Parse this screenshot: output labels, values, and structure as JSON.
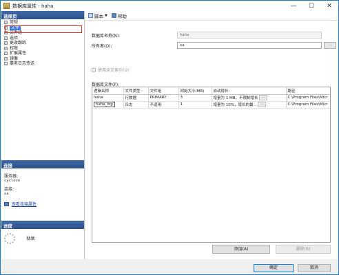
{
  "window": {
    "title": "数据库属性 - haha"
  },
  "left": {
    "select_page_heading": "选择页",
    "pages": [
      {
        "label": "常规"
      },
      {
        "label": "文件"
      },
      {
        "label": "文件组"
      },
      {
        "label": "选项"
      },
      {
        "label": "更改跟踪"
      },
      {
        "label": "权限"
      },
      {
        "label": "扩展属性"
      },
      {
        "label": "镜像"
      },
      {
        "label": "事务日志传送"
      }
    ],
    "connection_heading": "连接",
    "server_label": "服务器:",
    "server_value": "cyclove",
    "connection_label": "连接:",
    "connection_value": "sa",
    "view_link": "查看连接属性",
    "progress_heading": "进度",
    "progress_status": "就绪"
  },
  "toolbar": {
    "script": "脚本",
    "help": "帮助"
  },
  "form": {
    "db_name_label": "数据库名称(N):",
    "db_name_value": "haha",
    "owner_label": "所有者(O):",
    "owner_value": "sa",
    "fulltext_label": "使用全文索引(U)",
    "files_label": "数据库文件(F):"
  },
  "files_table": {
    "headers": [
      "逻辑名称",
      "文件类型",
      "文件组",
      "初始大小(MB)",
      "自动增长",
      "路径"
    ],
    "rows": [
      {
        "name": "haha",
        "type": "行数据",
        "group": "PRIMARY",
        "size": "3",
        "growth": "增量为 1 MB，不限制增长",
        "path": "C:\\Program Files\\Micr"
      },
      {
        "name": "haha_log",
        "type": "日志",
        "group": "不适用",
        "size": "1",
        "growth": "增量为 10%，增长的最...",
        "path": "C:\\Program Files\\Micr"
      }
    ]
  },
  "buttons": {
    "add": "添加(A)",
    "remove": "删除(R)",
    "ok": "确定",
    "cancel": "取消"
  }
}
